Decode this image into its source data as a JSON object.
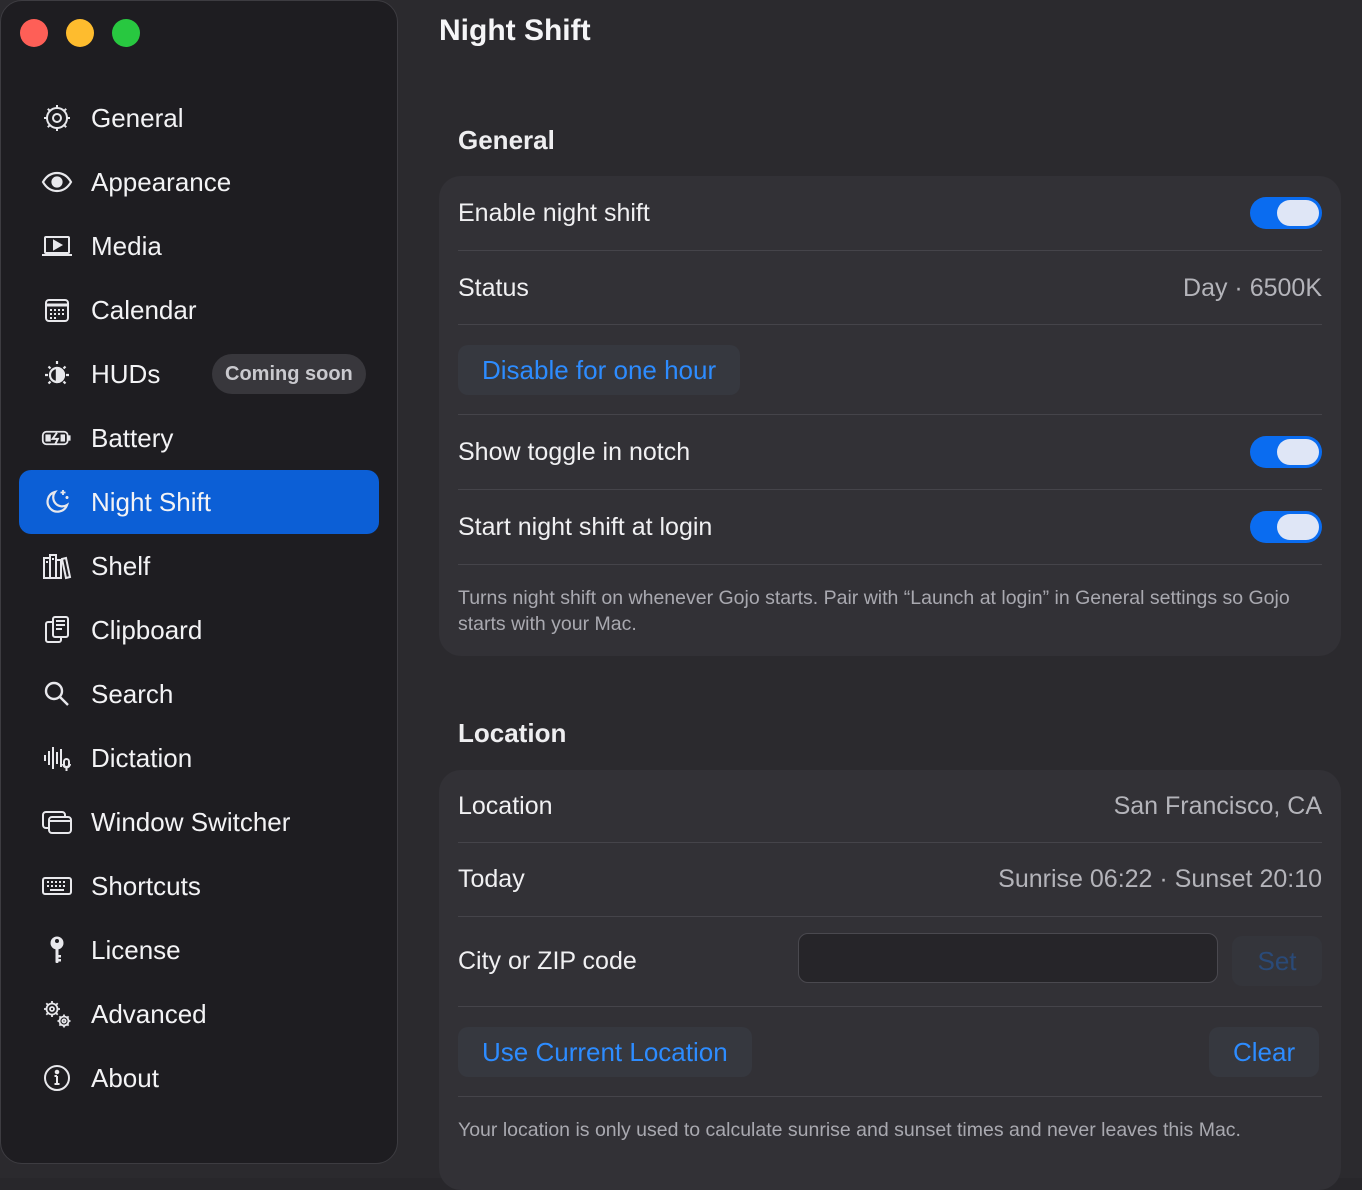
{
  "sidebar": {
    "items": [
      {
        "label": "General",
        "icon": "gear-icon"
      },
      {
        "label": "Appearance",
        "icon": "eye-icon"
      },
      {
        "label": "Media",
        "icon": "play-screen-icon"
      },
      {
        "label": "Calendar",
        "icon": "calendar-icon"
      },
      {
        "label": "HUDs",
        "icon": "brightness-icon",
        "badge": "Coming soon"
      },
      {
        "label": "Battery",
        "icon": "battery-charging-icon"
      },
      {
        "label": "Night Shift",
        "icon": "moon-stars-icon",
        "active": true
      },
      {
        "label": "Shelf",
        "icon": "books-icon"
      },
      {
        "label": "Clipboard",
        "icon": "clipboard-icon"
      },
      {
        "label": "Search",
        "icon": "magnifier-icon"
      },
      {
        "label": "Dictation",
        "icon": "waveform-mic-icon"
      },
      {
        "label": "Window Switcher",
        "icon": "windows-icon"
      },
      {
        "label": "Shortcuts",
        "icon": "keyboard-icon"
      },
      {
        "label": "License",
        "icon": "key-icon"
      },
      {
        "label": "Advanced",
        "icon": "gears-icon"
      },
      {
        "label": "About",
        "icon": "info-icon"
      }
    ]
  },
  "main": {
    "title": "Night Shift",
    "general": {
      "title": "General",
      "enable_label": "Enable night shift",
      "enable_on": true,
      "status_label": "Status",
      "status_value": "Day · 6500K",
      "disable_button": "Disable for one hour",
      "notch_label": "Show toggle in notch",
      "notch_on": true,
      "login_label": "Start night shift at login",
      "login_on": true,
      "login_note": "Turns night shift on whenever Gojo starts. Pair with “Launch at login” in General settings so Gojo starts with your Mac."
    },
    "location": {
      "title": "Location",
      "location_label": "Location",
      "location_value": "San Francisco, CA",
      "today_label": "Today",
      "today_value": "Sunrise 06:22 · Sunset 20:10",
      "city_label": "City or ZIP code",
      "city_value": "",
      "set_button": "Set",
      "use_current_button": "Use Current Location",
      "clear_button": "Clear",
      "privacy_note": "Your location is only used to calculate sunrise and sunset times and never leaves this Mac."
    }
  },
  "colors": {
    "accent": "#0a6cf0",
    "active_nav": "#0c5fd6",
    "link": "#2d8cff"
  }
}
